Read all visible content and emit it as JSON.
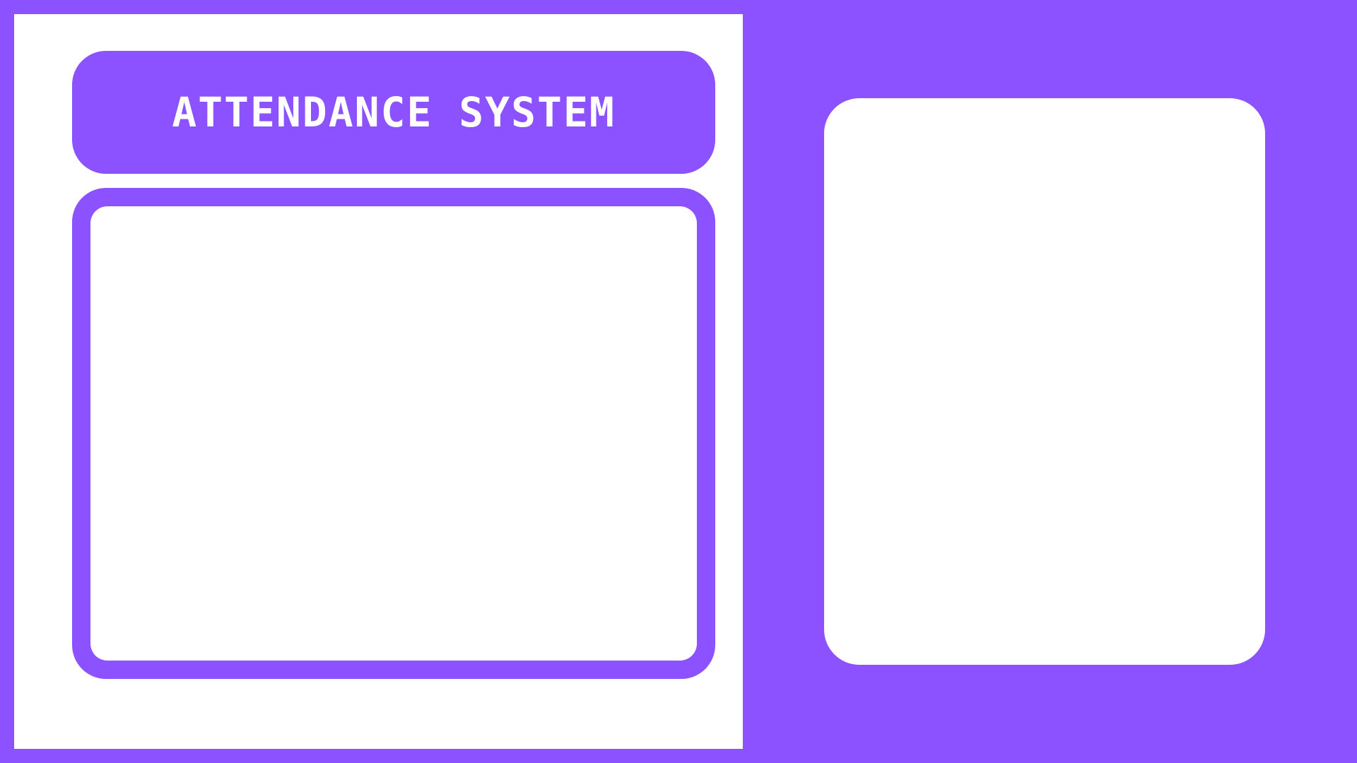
{
  "app": {
    "title": "ATTENDANCE SYSTEM"
  },
  "theme": {
    "accent": "#8c52ff",
    "surface": "#ffffff"
  }
}
